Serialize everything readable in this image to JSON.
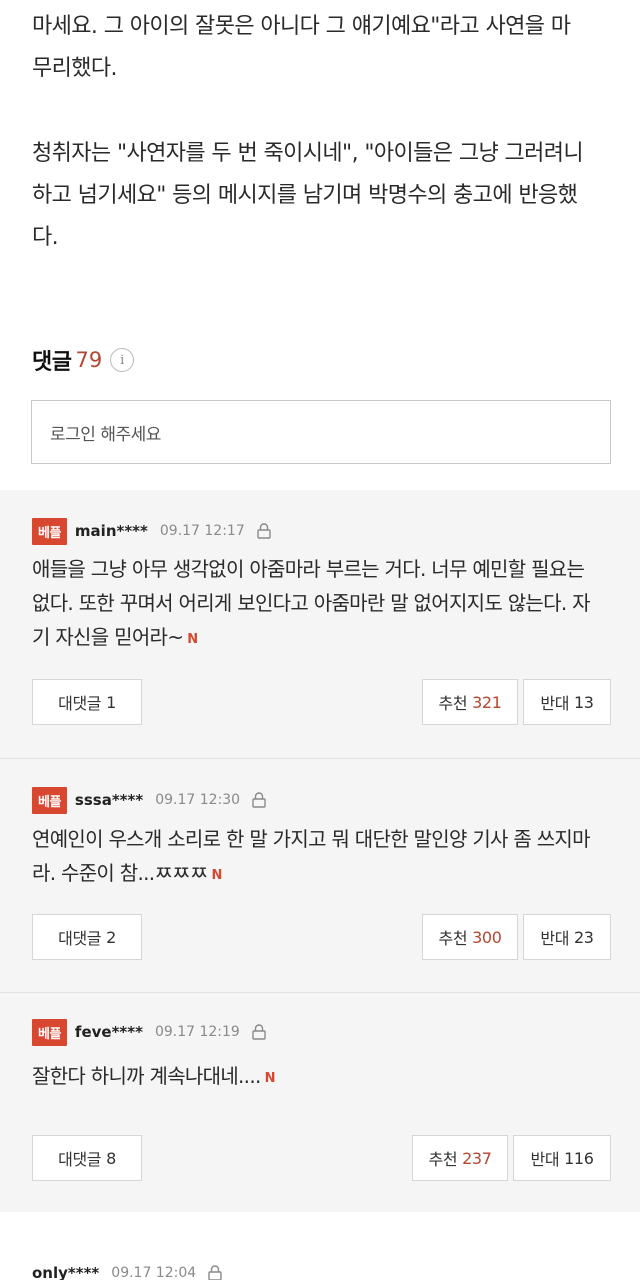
{
  "article": {
    "paragraph1_line1": "마세요. 그 아이의 잘못은 아니다 그 얘기예요\"라고 사연을 마",
    "paragraph1_line2": "무리했다.",
    "paragraph2_line1": "청취자는 \"사연자를 두 번 죽이시네\", \"아이들은 그냥 그러려니",
    "paragraph2_line2": "하고 넘기세요\" 등의 메시지를 남기며 박명수의 충고에 반응했",
    "paragraph2_line3": "다."
  },
  "comments_section": {
    "title": "댓글",
    "count": "79",
    "info_glyph": "i",
    "login_prompt": "로그인 해주세요"
  },
  "comments": [
    {
      "badge": "베플",
      "username": "main****",
      "timestamp": "09.17 12:17",
      "text_line1": "애들을 그냥 아무 생각없이 아줌마라 부르는 거다. 너무 예민할 필요는",
      "text_line2": "없다. 또한 꾸며서 어리게 보인다고 아줌마란 말 없어지지도 않는다. 자",
      "text_line3": "기 자신을 믿어라~",
      "n_mark": "N",
      "reply_label": "대댓글",
      "reply_count": "1",
      "like_label": "추천",
      "like_count": "321",
      "dislike_label": "반대",
      "dislike_count": "13"
    },
    {
      "badge": "베플",
      "username": "sssa****",
      "timestamp": "09.17 12:30",
      "text_line1": "연예인이 우스개 소리로 한 말 가지고 뭐 대단한 말인양 기사 좀 쓰지마",
      "text_line2": "라. 수준이 참...ㅉㅉㅉ",
      "n_mark": "N",
      "reply_label": "대댓글",
      "reply_count": "2",
      "like_label": "추천",
      "like_count": "300",
      "dislike_label": "반대",
      "dislike_count": "23"
    },
    {
      "badge": "베플",
      "username": "feve****",
      "timestamp": "09.17 12:19",
      "text_line1": "잘한다 하니까 계속나대네....",
      "n_mark": "N",
      "reply_label": "대댓글",
      "reply_count": "8",
      "like_label": "추천",
      "like_count": "237",
      "dislike_label": "반대",
      "dislike_count": "116"
    }
  ],
  "last_comment": {
    "username": "only****",
    "timestamp": "09.17 12:04"
  },
  "colors": {
    "accent": "#d8472f",
    "count_red": "#b5462f",
    "comments_bg": "#f5f5f5"
  },
  "icons": {
    "lock": "lock-icon",
    "info": "info-icon",
    "new_mark": "new-n-icon"
  }
}
